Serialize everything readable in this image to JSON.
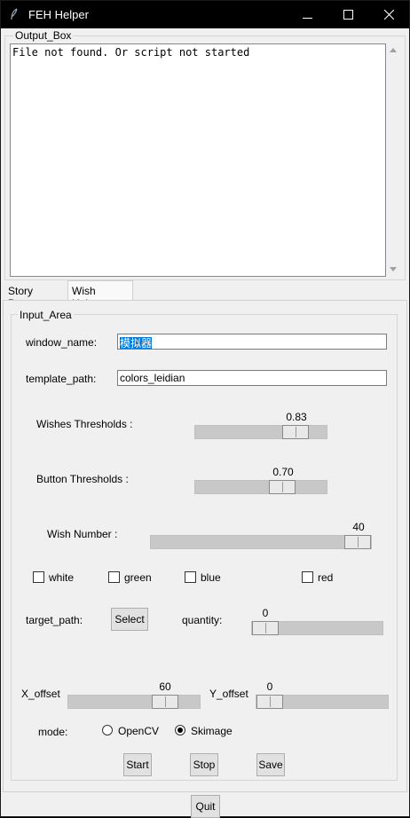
{
  "window": {
    "title": "FEH Helper",
    "minimize_glyph": "—",
    "maximize_glyph": "☐",
    "close_glyph": "✕"
  },
  "output_box": {
    "label": "Output_Box",
    "text": "File not found. Or script not started"
  },
  "tabs": [
    {
      "label": "Story Passer",
      "active": false
    },
    {
      "label": "Wish Helper",
      "active": true
    }
  ],
  "input_area": {
    "label": "Input_Area",
    "window_name_label": "window_name:",
    "window_name_value": "模拟器",
    "template_path_label": "template_path:",
    "template_path_value": "colors_leidian",
    "wishes_thresholds_label": "Wishes Thresholds :",
    "wishes_thresholds_value": "0.83",
    "wishes_thresholds_fraction": 0.83,
    "button_thresholds_label": "Button Thresholds :",
    "button_thresholds_value": "0.70",
    "button_thresholds_fraction": 0.7,
    "wish_number_label": "Wish Number :",
    "wish_number_value": "40",
    "wish_number_fraction": 1.0,
    "colors": [
      {
        "label": "white",
        "checked": false
      },
      {
        "label": "green",
        "checked": false
      },
      {
        "label": "blue",
        "checked": false
      },
      {
        "label": "red",
        "checked": false
      }
    ],
    "target_path_label": "target_path:",
    "select_button": "Select",
    "quantity_label": "quantity:",
    "quantity_value": "0",
    "x_offset_label": "X_offset",
    "x_offset_value": "60",
    "y_offset_label": "Y_offset",
    "y_offset_value": "0",
    "mode_label": "mode:",
    "mode_options": [
      {
        "label": "OpenCV",
        "selected": false
      },
      {
        "label": "Skimage",
        "selected": true
      }
    ],
    "start_button": "Start",
    "stop_button": "Stop",
    "save_button": "Save"
  },
  "quit_button": "Quit"
}
